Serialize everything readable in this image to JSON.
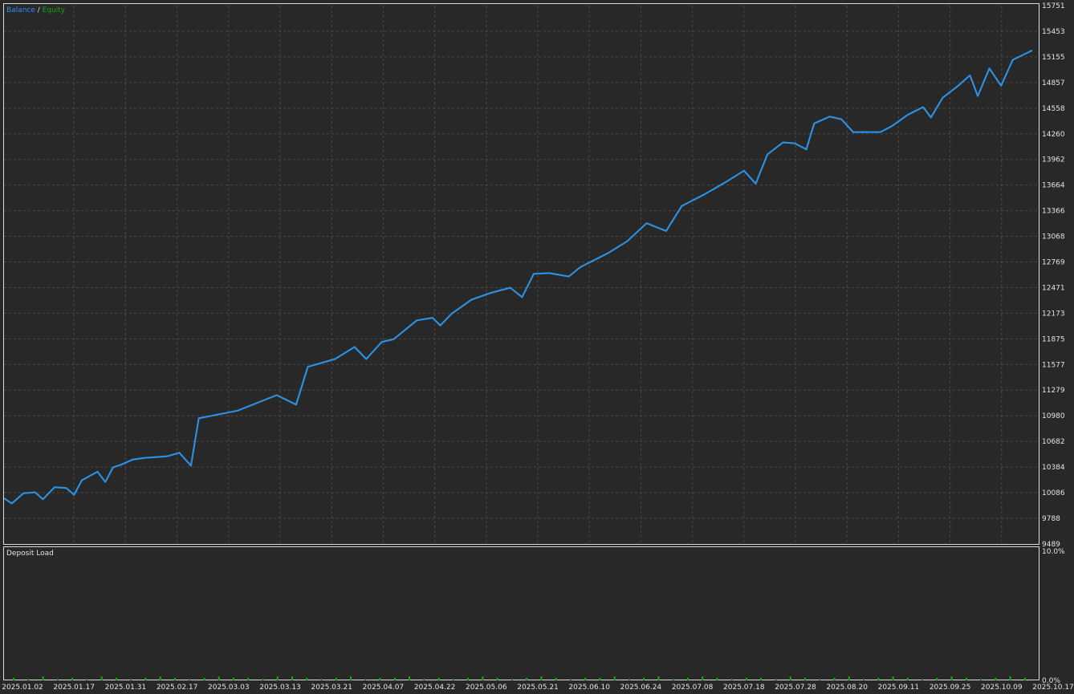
{
  "legend": {
    "balance_label": "Balance",
    "separator": " / ",
    "equity_label": "Equity"
  },
  "colors": {
    "background": "#282828",
    "grid": "#4a4a4a",
    "frame": "#dcdcdc",
    "balance": "#2e8ef0",
    "equity": "#12a812",
    "deposit_load": "#12b012"
  },
  "chart_data": [
    {
      "type": "line",
      "title": "",
      "ylim": [
        9489,
        15751
      ],
      "y_ticks": [
        "15751",
        "15453",
        "15155",
        "14857",
        "14558",
        "14260",
        "13962",
        "13664",
        "13366",
        "13068",
        "12769",
        "12471",
        "12173",
        "11875",
        "11577",
        "11279",
        "10980",
        "10682",
        "10384",
        "10086",
        "9788",
        "9489"
      ],
      "x_ticks": [
        "2025.01.02",
        "2025.01.17",
        "2025.01.31",
        "2025.02.17",
        "2025.03.03",
        "2025.03.13",
        "2025.03.21",
        "2025.04.07",
        "2025.04.22",
        "2025.05.06",
        "2025.05.21",
        "2025.06.10",
        "2025.06.24",
        "2025.07.08",
        "2025.07.18",
        "2025.07.28",
        "2025.08.20",
        "2025.09.11",
        "2025.09.25",
        "2025.10.09",
        "2025.10.17"
      ],
      "grid": true,
      "legend_position": "top-left",
      "series": [
        {
          "name": "Balance",
          "points": [
            [
              0,
              10020
            ],
            [
              0.02,
              9960
            ],
            [
              0.05,
              10080
            ],
            [
              0.08,
              10090
            ],
            [
              0.1,
              10010
            ],
            [
              0.13,
              10150
            ],
            [
              0.16,
              10140
            ],
            [
              0.18,
              10060
            ],
            [
              0.2,
              10230
            ],
            [
              0.24,
              10330
            ],
            [
              0.26,
              10210
            ],
            [
              0.28,
              10380
            ],
            [
              0.3,
              10410
            ],
            [
              0.33,
              10470
            ],
            [
              0.36,
              10490
            ],
            [
              0.39,
              10500
            ],
            [
              0.42,
              10510
            ],
            [
              0.45,
              10550
            ],
            [
              0.48,
              10400
            ],
            [
              0.5,
              10950
            ],
            [
              0.6,
              11040
            ],
            [
              0.7,
              11220
            ],
            [
              0.75,
              11110
            ],
            [
              0.78,
              11550
            ],
            [
              0.85,
              11640
            ],
            [
              0.9,
              11780
            ],
            [
              0.93,
              11640
            ],
            [
              0.97,
              11840
            ],
            [
              1.0,
              11870
            ],
            [
              1.06,
              12090
            ],
            [
              1.1,
              12120
            ],
            [
              1.12,
              12030
            ],
            [
              1.15,
              12170
            ],
            [
              1.2,
              12330
            ],
            [
              1.25,
              12410
            ],
            [
              1.3,
              12470
            ],
            [
              1.33,
              12360
            ],
            [
              1.36,
              12630
            ],
            [
              1.4,
              12640
            ],
            [
              1.45,
              12600
            ],
            [
              1.48,
              12710
            ],
            [
              1.55,
              12870
            ],
            [
              1.6,
              13010
            ],
            [
              1.65,
              13220
            ],
            [
              1.7,
              13130
            ],
            [
              1.74,
              13420
            ],
            [
              1.8,
              13560
            ],
            [
              1.85,
              13690
            ],
            [
              1.9,
              13830
            ],
            [
              1.93,
              13680
            ],
            [
              1.96,
              14020
            ],
            [
              2.0,
              14160
            ],
            [
              2.03,
              14150
            ],
            [
              2.06,
              14080
            ],
            [
              2.08,
              14380
            ],
            [
              2.12,
              14460
            ],
            [
              2.15,
              14430
            ],
            [
              2.18,
              14280
            ],
            [
              2.25,
              14280
            ],
            [
              2.28,
              14350
            ],
            [
              2.32,
              14480
            ],
            [
              2.36,
              14570
            ],
            [
              2.38,
              14450
            ],
            [
              2.41,
              14680
            ],
            [
              2.45,
              14820
            ],
            [
              2.48,
              14940
            ],
            [
              2.5,
              14700
            ],
            [
              2.53,
              15020
            ],
            [
              2.56,
              14820
            ],
            [
              2.59,
              15120
            ],
            [
              2.64,
              15230
            ]
          ]
        },
        {
          "name": "Equity",
          "points": [
            [
              0,
              10020
            ],
            [
              0.02,
              9960
            ],
            [
              0.05,
              10080
            ],
            [
              0.08,
              10090
            ],
            [
              0.1,
              10010
            ],
            [
              0.13,
              10150
            ],
            [
              0.16,
              10140
            ],
            [
              0.18,
              10060
            ],
            [
              0.2,
              10230
            ],
            [
              0.24,
              10330
            ],
            [
              0.26,
              10210
            ],
            [
              0.28,
              10380
            ],
            [
              0.3,
              10410
            ],
            [
              0.33,
              10470
            ],
            [
              0.36,
              10490
            ],
            [
              0.39,
              10500
            ],
            [
              0.42,
              10510
            ],
            [
              0.45,
              10550
            ],
            [
              0.48,
              10400
            ],
            [
              0.5,
              10950
            ],
            [
              0.6,
              11040
            ],
            [
              0.7,
              11220
            ],
            [
              0.75,
              11110
            ],
            [
              0.78,
              11550
            ],
            [
              0.85,
              11640
            ],
            [
              0.9,
              11780
            ],
            [
              0.93,
              11640
            ],
            [
              0.97,
              11840
            ],
            [
              1.0,
              11870
            ],
            [
              1.06,
              12090
            ],
            [
              1.1,
              12120
            ],
            [
              1.12,
              12030
            ],
            [
              1.15,
              12170
            ],
            [
              1.2,
              12330
            ],
            [
              1.25,
              12410
            ],
            [
              1.3,
              12470
            ],
            [
              1.33,
              12360
            ],
            [
              1.36,
              12630
            ],
            [
              1.4,
              12640
            ],
            [
              1.45,
              12600
            ],
            [
              1.48,
              12710
            ],
            [
              1.55,
              12870
            ],
            [
              1.6,
              13010
            ],
            [
              1.65,
              13220
            ],
            [
              1.7,
              13130
            ],
            [
              1.74,
              13420
            ],
            [
              1.8,
              13560
            ],
            [
              1.85,
              13690
            ],
            [
              1.9,
              13830
            ],
            [
              1.93,
              13680
            ],
            [
              1.96,
              14020
            ],
            [
              2.0,
              14160
            ],
            [
              2.03,
              14150
            ],
            [
              2.06,
              14080
            ],
            [
              2.08,
              14380
            ],
            [
              2.12,
              14460
            ],
            [
              2.15,
              14430
            ],
            [
              2.18,
              14280
            ],
            [
              2.25,
              14280
            ],
            [
              2.28,
              14350
            ],
            [
              2.32,
              14480
            ],
            [
              2.36,
              14570
            ],
            [
              2.38,
              14450
            ],
            [
              2.41,
              14680
            ],
            [
              2.45,
              14820
            ],
            [
              2.48,
              14940
            ],
            [
              2.5,
              14700
            ],
            [
              2.53,
              15020
            ],
            [
              2.56,
              14820
            ],
            [
              2.59,
              15120
            ],
            [
              2.64,
              15230
            ]
          ]
        }
      ]
    },
    {
      "type": "bar",
      "title": "Deposit Load",
      "ylim": [
        0,
        10
      ],
      "y_ticks": [
        "10.0%",
        "0.0%"
      ],
      "values": [
        0.2,
        0.1,
        0.3,
        0.1,
        0.2,
        0.1,
        0.3,
        0.2,
        0.1,
        0.2,
        0.3,
        0.2,
        0.1,
        0.2,
        0.3,
        0.2,
        0.2,
        0.1,
        0.3,
        0.3,
        0.2,
        0.1,
        0.2,
        0.3,
        0.1,
        0.2,
        0.2,
        0.3,
        0.1,
        0.2,
        0.1,
        0.2,
        0.3,
        0.2,
        0.1,
        0.2,
        0.3,
        0.2,
        0.1,
        0.2,
        0.2,
        0.3,
        0.1,
        0.2,
        0.3,
        0.1,
        0.2,
        0.3,
        0.2,
        0.1,
        0.2,
        0.2,
        0.1,
        0.3,
        0.2,
        0.1,
        0.2,
        0.3,
        0.1,
        0.2,
        0.3,
        0.2,
        0.1,
        0.2,
        0.3,
        0.2,
        0.1,
        0.2,
        0.3,
        0.2
      ]
    }
  ]
}
